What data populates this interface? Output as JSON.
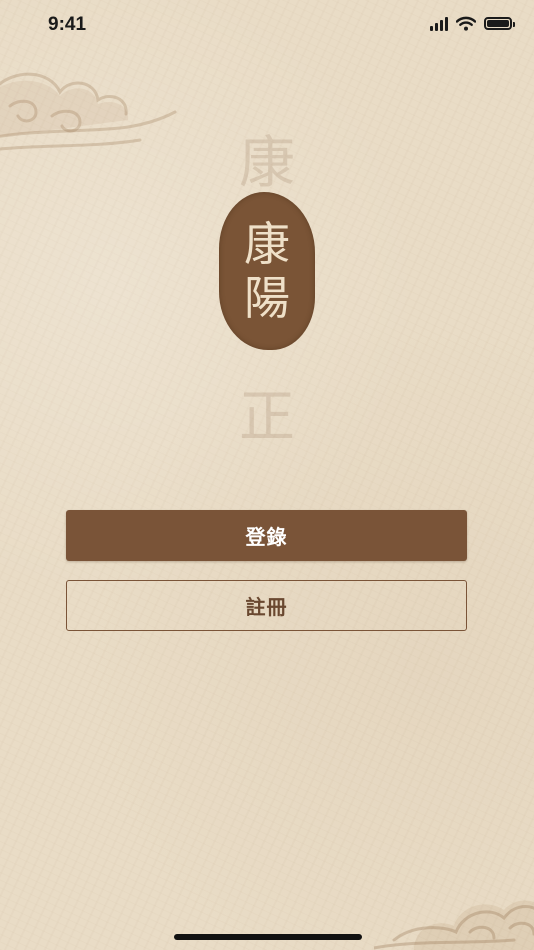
{
  "status_bar": {
    "time": "9:41",
    "icons": [
      "signal-icon",
      "wifi-icon",
      "battery-icon"
    ]
  },
  "background": {
    "top_character": "康",
    "bottom_character": "正",
    "decorations": [
      "cloud-icon",
      "cloud-icon"
    ]
  },
  "logo": {
    "characters": [
      "康",
      "陽"
    ]
  },
  "actions": {
    "login_label": "登錄",
    "register_label": "註冊"
  },
  "colors": {
    "background": "#e9dcc6",
    "primary": "#7a5438",
    "primary_text": "#ffffff",
    "outline_text": "#6a4830"
  }
}
